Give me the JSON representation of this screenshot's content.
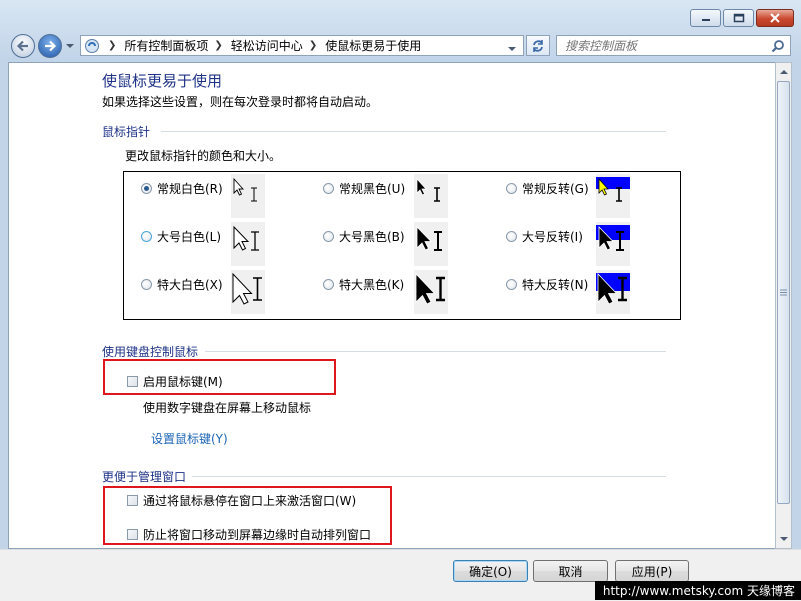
{
  "window": {
    "caption_buttons": [
      "minimize-icon",
      "maximize-icon",
      "close-icon"
    ]
  },
  "nav": {
    "breadcrumbs": [
      "所有控制面板项",
      "轻松访问中心",
      "使鼠标更易于使用"
    ],
    "search_placeholder": "搜索控制面板"
  },
  "page": {
    "title": "使鼠标更易于使用",
    "subtitle": "如果选择这些设置，则在每次登录时都将自动启动。"
  },
  "pointers": {
    "header": "鼠标指针",
    "description": "更改鼠标指针的颜色和大小。",
    "options": [
      {
        "label": "常规白色(R)",
        "checked": true
      },
      {
        "label": "常规黑色(U)",
        "checked": false
      },
      {
        "label": "常规反转(G)",
        "checked": false
      },
      {
        "label": "大号白色(L)",
        "checked": false
      },
      {
        "label": "大号黑色(B)",
        "checked": false
      },
      {
        "label": "大号反转(I)",
        "checked": false
      },
      {
        "label": "特大白色(X)",
        "checked": false
      },
      {
        "label": "特大黑色(K)",
        "checked": false
      },
      {
        "label": "特大反转(N)",
        "checked": false
      }
    ]
  },
  "keyboard": {
    "header": "使用键盘控制鼠标",
    "mouse_keys_label": "启用鼠标键(M)",
    "mouse_keys_checked": false,
    "mouse_keys_desc": "使用数字键盘在屏幕上移动鼠标",
    "setup_link": "设置鼠标键(Y)"
  },
  "windows": {
    "header": "更便于管理窗口",
    "hover_activate_label": "通过将鼠标悬停在窗口上来激活窗口(W)",
    "hover_activate_checked": false,
    "prevent_arrange_label": "防止将窗口移动到屏幕边缘时自动排列窗口",
    "prevent_arrange_checked": false
  },
  "buttons": {
    "ok": "确定(O)",
    "cancel": "取消",
    "apply": "应用(P)"
  },
  "watermark": "http://www.metsky.com  天缘博客",
  "colors": {
    "heading": "#1e3287",
    "link": "#1a64b4",
    "highlight_box": "#e0161e",
    "inverse_blue": "#0000ff"
  }
}
